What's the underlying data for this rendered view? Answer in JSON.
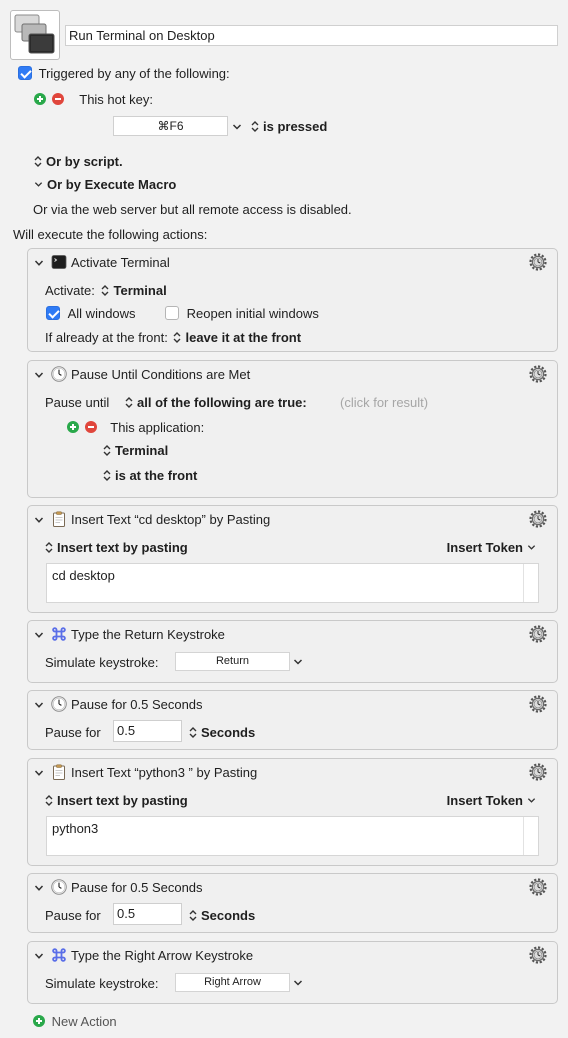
{
  "macro": {
    "name": "Run Terminal on Desktop",
    "triggered_label": "Triggered by any of the following:",
    "hotkey_label": "This hot key:",
    "hotkey_value": "⌘F6",
    "hotkey_condition": "is pressed",
    "or_script": "Or by script.",
    "or_execute_macro": "Or by Execute Macro",
    "web_server_note": "Or via the web server but all remote access is disabled.",
    "will_execute": "Will execute the following actions:",
    "new_action": "New Action"
  },
  "actions": [
    {
      "icon": "terminal-icon",
      "title": "Activate Terminal",
      "activate_label": "Activate:",
      "activate_value": "Terminal",
      "all_windows": "All windows",
      "all_windows_checked": true,
      "reopen": "Reopen initial windows",
      "reopen_checked": false,
      "front_label": "If already at the front:",
      "front_value": "leave it at the front"
    },
    {
      "icon": "clock-icon",
      "title": "Pause Until Conditions are Met",
      "pause_until": "Pause until",
      "condition_mode": "all of the following are true:",
      "result_hint": "(click for result)",
      "this_application": "This application:",
      "app_value": "Terminal",
      "app_condition": "is at the front"
    },
    {
      "icon": "clipboard-icon",
      "title": "Insert Text “cd desktop” by Pasting",
      "mode": "Insert text by pasting",
      "token": "Insert Token",
      "text": "cd desktop"
    },
    {
      "icon": "command-icon",
      "title": "Type the Return Keystroke",
      "simulate_label": "Simulate keystroke:",
      "key": "Return"
    },
    {
      "icon": "clock-icon",
      "title": "Pause for 0.5 Seconds",
      "pause_for": "Pause for",
      "value": "0.5",
      "unit": "Seconds"
    },
    {
      "icon": "clipboard-icon",
      "title": "Insert Text “python3 ” by Pasting",
      "mode": "Insert text by pasting",
      "token": "Insert Token",
      "text": "python3"
    },
    {
      "icon": "clock-icon",
      "title": "Pause for 0.5 Seconds",
      "pause_for": "Pause for",
      "value": "0.5",
      "unit": "Seconds"
    },
    {
      "icon": "command-icon",
      "title": "Type the Right Arrow Keystroke",
      "simulate_label": "Simulate keystroke:",
      "key": "Right Arrow"
    }
  ],
  "colors": {
    "accent": "#2f7bf5",
    "add_green": "#29a84a",
    "remove_red": "#e0463c",
    "command_icon": "#5a6ee8"
  }
}
